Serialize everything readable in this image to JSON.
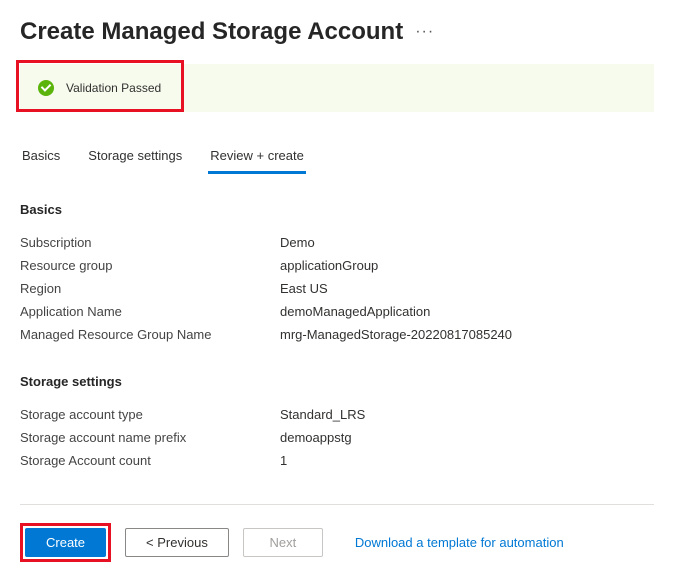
{
  "header": {
    "title": "Create Managed Storage Account",
    "more": "···"
  },
  "validation": {
    "message": "Validation Passed"
  },
  "tabs": [
    {
      "label": "Basics",
      "active": false
    },
    {
      "label": "Storage settings",
      "active": false
    },
    {
      "label": "Review + create",
      "active": true
    }
  ],
  "sections": {
    "basics": {
      "title": "Basics",
      "rows": [
        {
          "label": "Subscription",
          "value": "Demo"
        },
        {
          "label": "Resource group",
          "value": "applicationGroup"
        },
        {
          "label": "Region",
          "value": "East US"
        },
        {
          "label": "Application Name",
          "value": "demoManagedApplication"
        },
        {
          "label": "Managed Resource Group Name",
          "value": "mrg-ManagedStorage-20220817085240"
        }
      ]
    },
    "storage": {
      "title": "Storage settings",
      "rows": [
        {
          "label": "Storage account type",
          "value": "Standard_LRS"
        },
        {
          "label": "Storage account name prefix",
          "value": "demoappstg"
        },
        {
          "label": "Storage Account count",
          "value": "1"
        }
      ]
    }
  },
  "footer": {
    "create": "Create",
    "previous": "< Previous",
    "next": "Next",
    "download_link": "Download a template for automation"
  }
}
